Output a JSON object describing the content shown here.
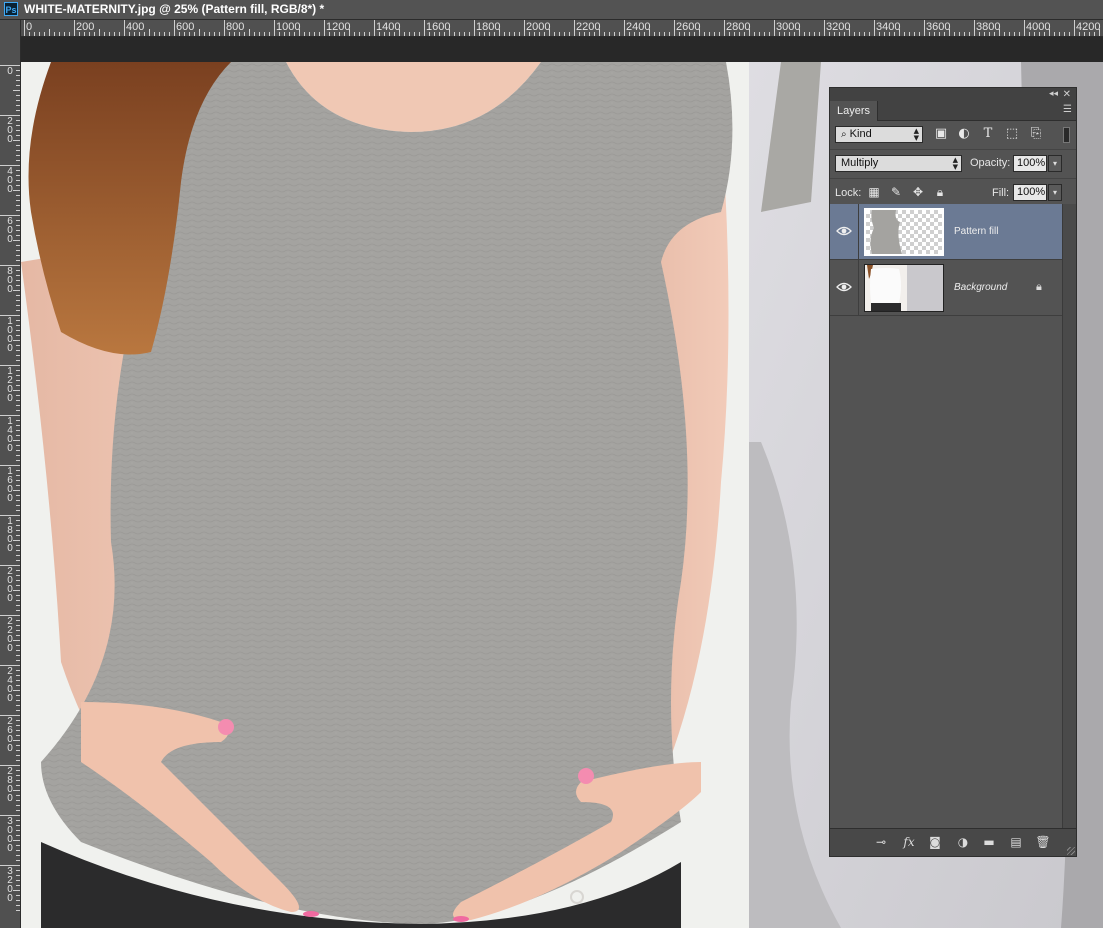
{
  "app": {
    "logo": "Ps"
  },
  "document": {
    "title": "WHITE-MATERNITY.jpg @ 25% (Pattern fill, RGB/8*) *"
  },
  "rulers": {
    "horizontal": [
      "0",
      "200",
      "400",
      "600",
      "800",
      "1000",
      "1200",
      "1400",
      "1600",
      "1800",
      "2000",
      "2200",
      "2400",
      "2600",
      "2800",
      "3000",
      "3200",
      "3400",
      "3600",
      "3800",
      "4000",
      "4200"
    ],
    "vertical": [
      "0",
      "200",
      "400",
      "600",
      "800",
      "1000",
      "1200",
      "1400",
      "1600",
      "1800",
      "2000",
      "2200",
      "2400",
      "2600",
      "2800",
      "3000",
      "3200"
    ]
  },
  "layers_panel": {
    "title": "Layers",
    "collapse_glyph": "◂◂",
    "close_glyph": "✕",
    "menu_glyph": "☰",
    "filter": {
      "kind_label": "Kind",
      "icons": [
        "image-filter-icon",
        "adjustment-filter-icon",
        "type-filter-icon",
        "shape-filter-icon",
        "smart-object-filter-icon"
      ]
    },
    "blend_mode": "Multiply",
    "opacity_label": "Opacity:",
    "opacity_value": "100%",
    "lock_label": "Lock:",
    "fill_label": "Fill:",
    "fill_value": "100%",
    "layers": [
      {
        "name": "Pattern fill",
        "visible": true,
        "selected": true,
        "locked": false
      },
      {
        "name": "Background",
        "visible": true,
        "selected": false,
        "locked": true
      }
    ],
    "footer_icons": [
      "link-layers-icon",
      "fx-icon",
      "add-mask-icon",
      "adjustment-layer-icon",
      "new-group-icon",
      "new-layer-icon",
      "delete-layer-icon"
    ]
  },
  "colors": {
    "selection": "#6b7a94",
    "panel_bg": "#535353",
    "shirt_gray": "#a3a29f"
  }
}
